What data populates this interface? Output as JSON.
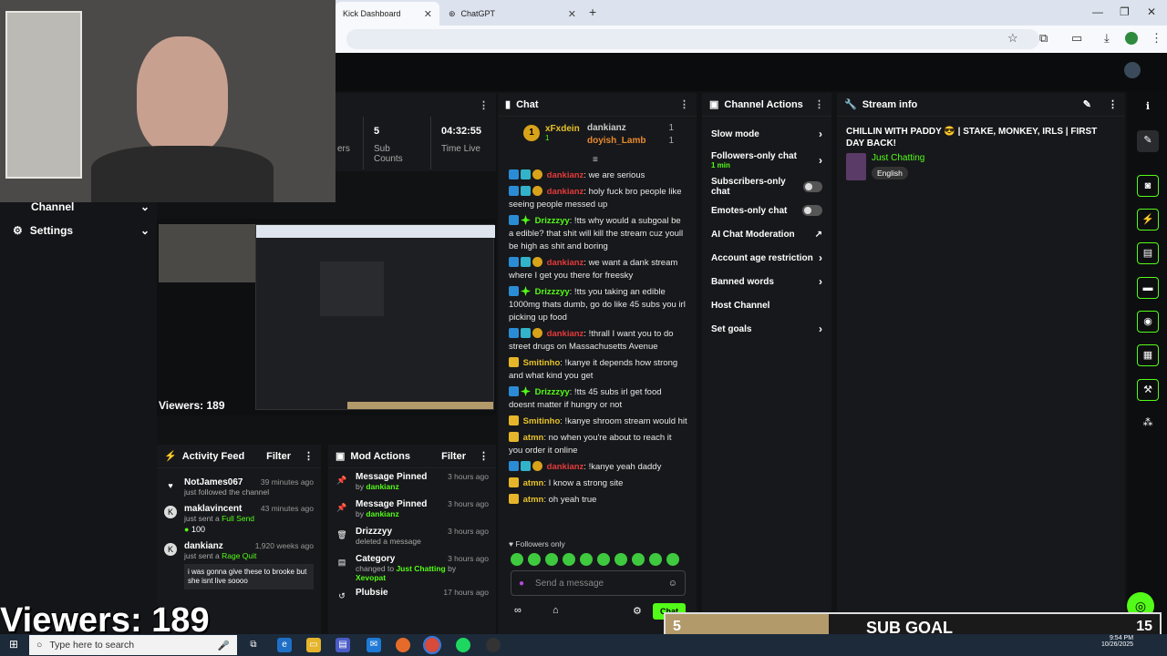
{
  "browser": {
    "tabs": [
      {
        "label": "Kick Dashboard"
      },
      {
        "label": "ChatGPT"
      }
    ],
    "new_tab": "+"
  },
  "stream_stats": [
    {
      "value": "",
      "label": "ers"
    },
    {
      "value": "5",
      "label": "Sub Counts"
    },
    {
      "value": "04:32:55",
      "label": "Time Live"
    }
  ],
  "sidebar": {
    "items": [
      {
        "label": "Channel",
        "icon": "channel-icon"
      },
      {
        "label": "Settings",
        "icon": "gear-icon"
      }
    ]
  },
  "preview": {
    "viewers": "Viewers: 189"
  },
  "chat": {
    "title": "Chat",
    "leaderboard": [
      {
        "rank": "1",
        "name": "xFxdein",
        "count": "1"
      },
      {
        "name": "dankianz",
        "count": "1"
      },
      {
        "name": "doyish_Lamb",
        "count": "1"
      }
    ],
    "messages": [
      {
        "user": "dankianz",
        "style": "red",
        "text": ": we are serious"
      },
      {
        "user": "dankianz",
        "style": "red",
        "text": ": holy fuck bro people like seeing people messed up"
      },
      {
        "user": "Drizzzyy",
        "style": "green",
        "text": ": !tts why would a subgoal be a edible? that shit will kill the stream cuz youll be high as shit and boring"
      },
      {
        "user": "dankianz",
        "style": "red",
        "text": ": we want a dank stream where I get you there for freesky"
      },
      {
        "user": "Drizzzyy",
        "style": "green",
        "text": ": !tts you taking an edible 1000mg thats dumb, go do like 45 subs you irl picking up food"
      },
      {
        "user": "dankianz",
        "style": "red",
        "text": ": !thrall I want you to do street drugs on Massachusetts Avenue"
      },
      {
        "user": "Smitinho",
        "style": "gold",
        "text": ": !kanye it depends how strong and what kind you get"
      },
      {
        "user": "Drizzzyy",
        "style": "green",
        "text": ": !tts 45 subs irl get food doesnt matter if hungry or not"
      },
      {
        "user": "Smitinho",
        "style": "gold",
        "text": ": !kanye shroom stream would hit"
      },
      {
        "user": "atmn",
        "style": "gold",
        "text": ": no when you're about to reach it you order it online"
      },
      {
        "user": "dankianz",
        "style": "red",
        "text": ": !kanye yeah daddy"
      },
      {
        "user": "atmn",
        "style": "gold",
        "text": ": I know a strong site"
      },
      {
        "user": "atmn",
        "style": "gold",
        "text": ": oh yeah true"
      }
    ],
    "followers_only": "Followers only",
    "input_placeholder": "Send a message",
    "send_label": "Chat"
  },
  "channel_actions": {
    "title": "Channel Actions",
    "items": [
      {
        "label": "Slow mode",
        "control": "chevron"
      },
      {
        "label": "Followers-only chat",
        "sub": "1 min",
        "control": "chevron"
      },
      {
        "label": "Subscribers-only chat",
        "control": "toggle"
      },
      {
        "label": "Emotes-only chat",
        "control": "toggle"
      },
      {
        "label": "AI Chat Moderation",
        "control": "chart"
      },
      {
        "label": "Account age restriction",
        "control": "chevron"
      },
      {
        "label": "Banned words",
        "control": "chevron"
      },
      {
        "label": "Host Channel",
        "control": "none"
      },
      {
        "label": "Set goals",
        "control": "chevron"
      }
    ]
  },
  "stream_info": {
    "title": "Stream info",
    "stream_title": "CHILLIN WITH PADDY 😎 | STAKE, MONKEY, IRLS | FIRST DAY BACK!",
    "category": "Just Chatting",
    "language": "English"
  },
  "activity_feed": {
    "title": "Activity Feed",
    "filter": "Filter",
    "items": [
      {
        "user": "NotJames067",
        "time": "39 minutes ago",
        "desc": "just followed the channel",
        "icon": "heart-icon"
      },
      {
        "user": "maklavincent",
        "time": "43 minutes ago",
        "desc": "just sent a ",
        "highlight": "Full Send",
        "amount": "100",
        "icon": "kick-icon"
      },
      {
        "user": "dankianz",
        "time": "1,920 weeks ago",
        "desc": "just sent a ",
        "highlight": "Rage Quit",
        "message": "i was gonna give these to brooke but she isnt live soooo",
        "icon": "kick-icon"
      }
    ]
  },
  "mod_actions": {
    "title": "Mod Actions",
    "filter": "Filter",
    "items": [
      {
        "title": "Message Pinned",
        "time": "3 hours ago",
        "by": "by ",
        "user": "dankianz",
        "icon": "pin-icon"
      },
      {
        "title": "Message Pinned",
        "time": "3 hours ago",
        "by": "by ",
        "user": "dankianz",
        "icon": "pin-icon"
      },
      {
        "title": "Drizzzyy",
        "time": "3 hours ago",
        "by": "deleted a message",
        "user": "",
        "icon": "trash-icon"
      },
      {
        "title": "Category",
        "time": "3 hours ago",
        "by": "changed to ",
        "user": "Just Chatting",
        "extra": " by ",
        "extra_user": "Xevopat",
        "icon": "category-icon"
      },
      {
        "title": "Plubsie",
        "time": "17 hours ago",
        "by": "",
        "user": "",
        "icon": "undo-icon"
      }
    ]
  },
  "overlay": {
    "viewers": "Viewers: 189",
    "goal_current": "5",
    "goal_label": "SUB GOAL",
    "goal_target": "15",
    "goal_progress": 0.33
  },
  "taskbar": {
    "search_placeholder": "Type here to search",
    "time": "9:54 PM",
    "date": "10/26/2025"
  }
}
